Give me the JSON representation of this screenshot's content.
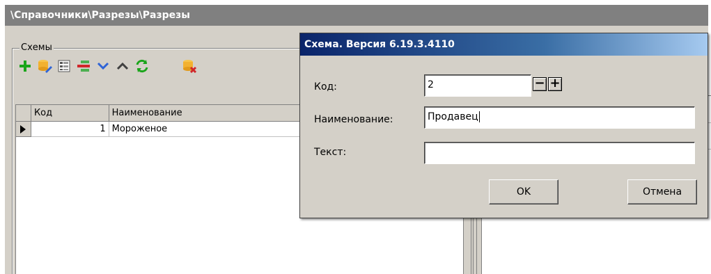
{
  "window": {
    "title": "\\Справочники\\Разрезы\\Разрезы"
  },
  "schemes_group": {
    "legend": "Схемы",
    "toolbar": [
      {
        "icon": "add-icon",
        "color": "#1aa51a"
      },
      {
        "icon": "database-edit-icon",
        "color": "#f2b130"
      },
      {
        "icon": "list-view-icon",
        "color": "#555555"
      },
      {
        "icon": "remove-row-icon",
        "color": "#d0262a"
      },
      {
        "icon": "chevron-down-icon",
        "color": "#2f64d6"
      },
      {
        "icon": "chevron-up-icon",
        "color": "#404040"
      },
      {
        "icon": "refresh-icon",
        "color": "#1aa51a"
      },
      {
        "icon": "database-delete-icon",
        "color": "#f2b130"
      }
    ],
    "grid": {
      "columns": [
        "Код",
        "Наименование"
      ],
      "rows": [
        {
          "code": "1",
          "name": "Мороженое",
          "selected": true
        }
      ]
    }
  },
  "dialog": {
    "title": "Схема. Версия 6.19.3.4110",
    "code_label": "Код:",
    "code_value": "2",
    "spin_minus": "−",
    "spin_plus": "+",
    "name_label": "Наименование:",
    "name_value": "Продавец",
    "text_label": "Текст:",
    "text_value": "",
    "ok_label": "OK",
    "cancel_label": "Отмена"
  }
}
